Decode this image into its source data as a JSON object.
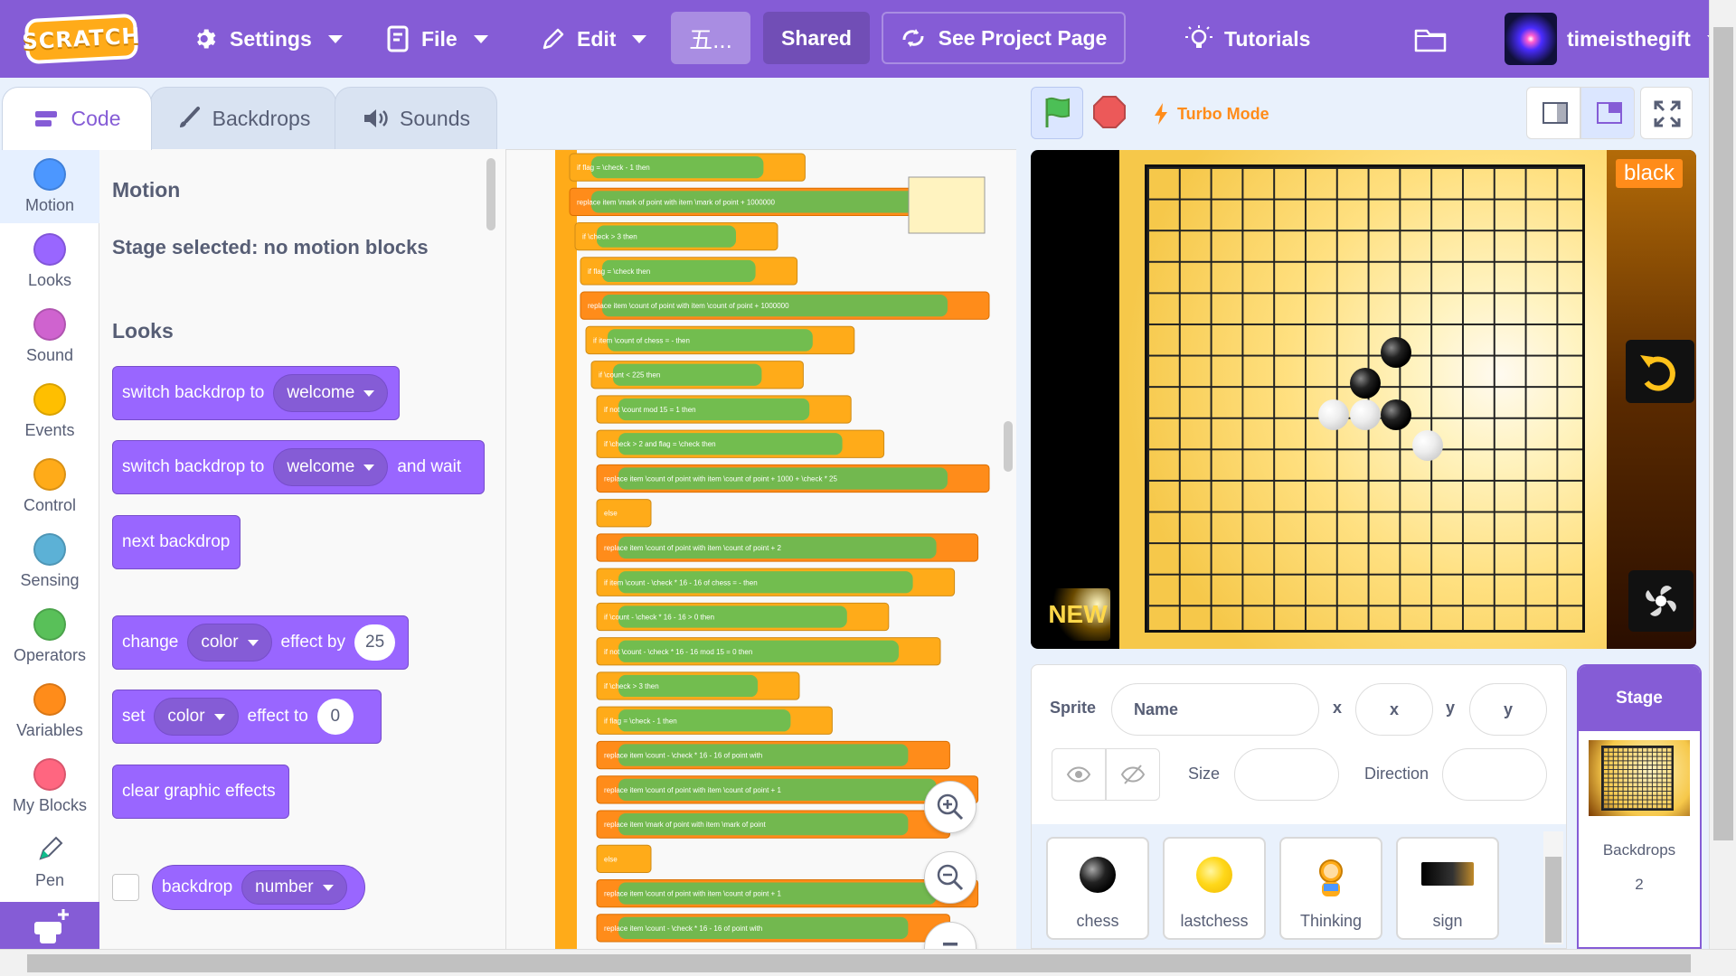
{
  "menubar": {
    "logo_text": "SCRATCH",
    "settings": "Settings",
    "file": "File",
    "edit": "Edit",
    "project_title": "五...",
    "shared": "Shared",
    "see_project_page": "See Project Page",
    "tutorials": "Tutorials",
    "username": "timeisthegift"
  },
  "tabs": [
    {
      "label": "Code"
    },
    {
      "label": "Backdrops"
    },
    {
      "label": "Sounds"
    }
  ],
  "categories": [
    {
      "label": "Motion",
      "color": "#4c97ff"
    },
    {
      "label": "Looks",
      "color": "#9966ff"
    },
    {
      "label": "Sound",
      "color": "#cf63cf"
    },
    {
      "label": "Events",
      "color": "#ffbf00"
    },
    {
      "label": "Control",
      "color": "#ffab19"
    },
    {
      "label": "Sensing",
      "color": "#5cb1d6"
    },
    {
      "label": "Operators",
      "color": "#59c059"
    },
    {
      "label": "Variables",
      "color": "#ff8c1a"
    },
    {
      "label": "My Blocks",
      "color": "#ff6680"
    },
    {
      "label": "Pen",
      "color": "#0fbd8c"
    }
  ],
  "palette": {
    "motion_heading": "Motion",
    "motion_note": "Stage selected: no motion blocks",
    "looks_heading": "Looks",
    "switch_backdrop": "switch backdrop to",
    "switch_backdrop_value": "welcome",
    "switch_backdrop_wait": "switch backdrop to",
    "switch_backdrop_wait_value": "welcome",
    "and_wait": "and wait",
    "next_backdrop": "next backdrop",
    "change": "change",
    "change_effect": "color",
    "effect_by": "effect by",
    "change_value": "25",
    "set": "set",
    "set_effect": "color",
    "effect_to": "effect to",
    "set_value": "0",
    "clear_effects": "clear graphic effects",
    "backdrop": "backdrop",
    "backdrop_prop": "number"
  },
  "code_area": {
    "script_rows": [
      {
        "kind": "if",
        "text": "if  flag = \\check - 1  then"
      },
      {
        "kind": "stack",
        "text": "replace item \\mark of point with item \\mark of point + 1000000"
      },
      {
        "kind": "if",
        "text": "if  \\check > 3  then"
      },
      {
        "kind": "if",
        "text": "if  flag = \\check  then"
      },
      {
        "kind": "stack",
        "text": "replace item \\count of point with item \\count of point + 1000000"
      },
      {
        "kind": "if",
        "text": "if  item \\count of chess = -  then"
      },
      {
        "kind": "if",
        "text": "if  \\count < 225  then"
      },
      {
        "kind": "if",
        "text": "if  not \\count mod 15 = 1  then"
      },
      {
        "kind": "if",
        "text": "if  \\check > 2 and flag = \\check  then"
      },
      {
        "kind": "stack",
        "text": "replace item \\count of point with item \\count of point + 1000 + \\check * 25"
      },
      {
        "kind": "else",
        "text": "else"
      },
      {
        "kind": "stack",
        "text": "replace item \\count of point with item \\count of point + 2"
      },
      {
        "kind": "if",
        "text": "if  item \\count - \\check * 16 - 16 of chess = -  then"
      },
      {
        "kind": "if",
        "text": "if  \\count - \\check * 16 - 16 > 0  then"
      },
      {
        "kind": "if",
        "text": "if  not \\count - \\check * 16 - 16 mod 15 = 0  then"
      },
      {
        "kind": "if",
        "text": "if  \\check > 3  then"
      },
      {
        "kind": "if",
        "text": "if  flag = \\check - 1  then"
      },
      {
        "kind": "stack",
        "text": "replace item \\count - \\check * 16 - 16 of point with"
      },
      {
        "kind": "stack",
        "text": "replace item \\count of point with item \\count of point + 1"
      },
      {
        "kind": "stack",
        "text": "replace item \\mark of point with item \\mark of point"
      },
      {
        "kind": "else",
        "text": "else"
      },
      {
        "kind": "stack",
        "text": "replace item \\count of point with item \\count of point + 1"
      },
      {
        "kind": "stack",
        "text": "replace item \\count - \\check * 16 - 16 of point with"
      }
    ]
  },
  "stage_header": {
    "turbo_mode": "Turbo Mode"
  },
  "stage": {
    "turn_label": "black",
    "new_label": "NEW",
    "stones": [
      {
        "color": "black",
        "col": 8,
        "row": 6
      },
      {
        "color": "black",
        "col": 7,
        "row": 7
      },
      {
        "color": "white",
        "col": 6,
        "row": 8
      },
      {
        "color": "white",
        "col": 7,
        "row": 8
      },
      {
        "color": "black",
        "col": 8,
        "row": 8
      },
      {
        "color": "white",
        "col": 9,
        "row": 9
      }
    ]
  },
  "sprite_info": {
    "sprite_label": "Sprite",
    "name_placeholder": "Name",
    "x_label": "x",
    "x_placeholder": "x",
    "y_label": "y",
    "y_placeholder": "y",
    "size_label": "Size",
    "direction_label": "Direction"
  },
  "sprites": [
    {
      "name": "chess"
    },
    {
      "name": "lastchess"
    },
    {
      "name": "Thinking"
    },
    {
      "name": "sign"
    }
  ],
  "stage_target": {
    "title": "Stage",
    "backdrops_label": "Backdrops",
    "backdrops_count": "2"
  }
}
